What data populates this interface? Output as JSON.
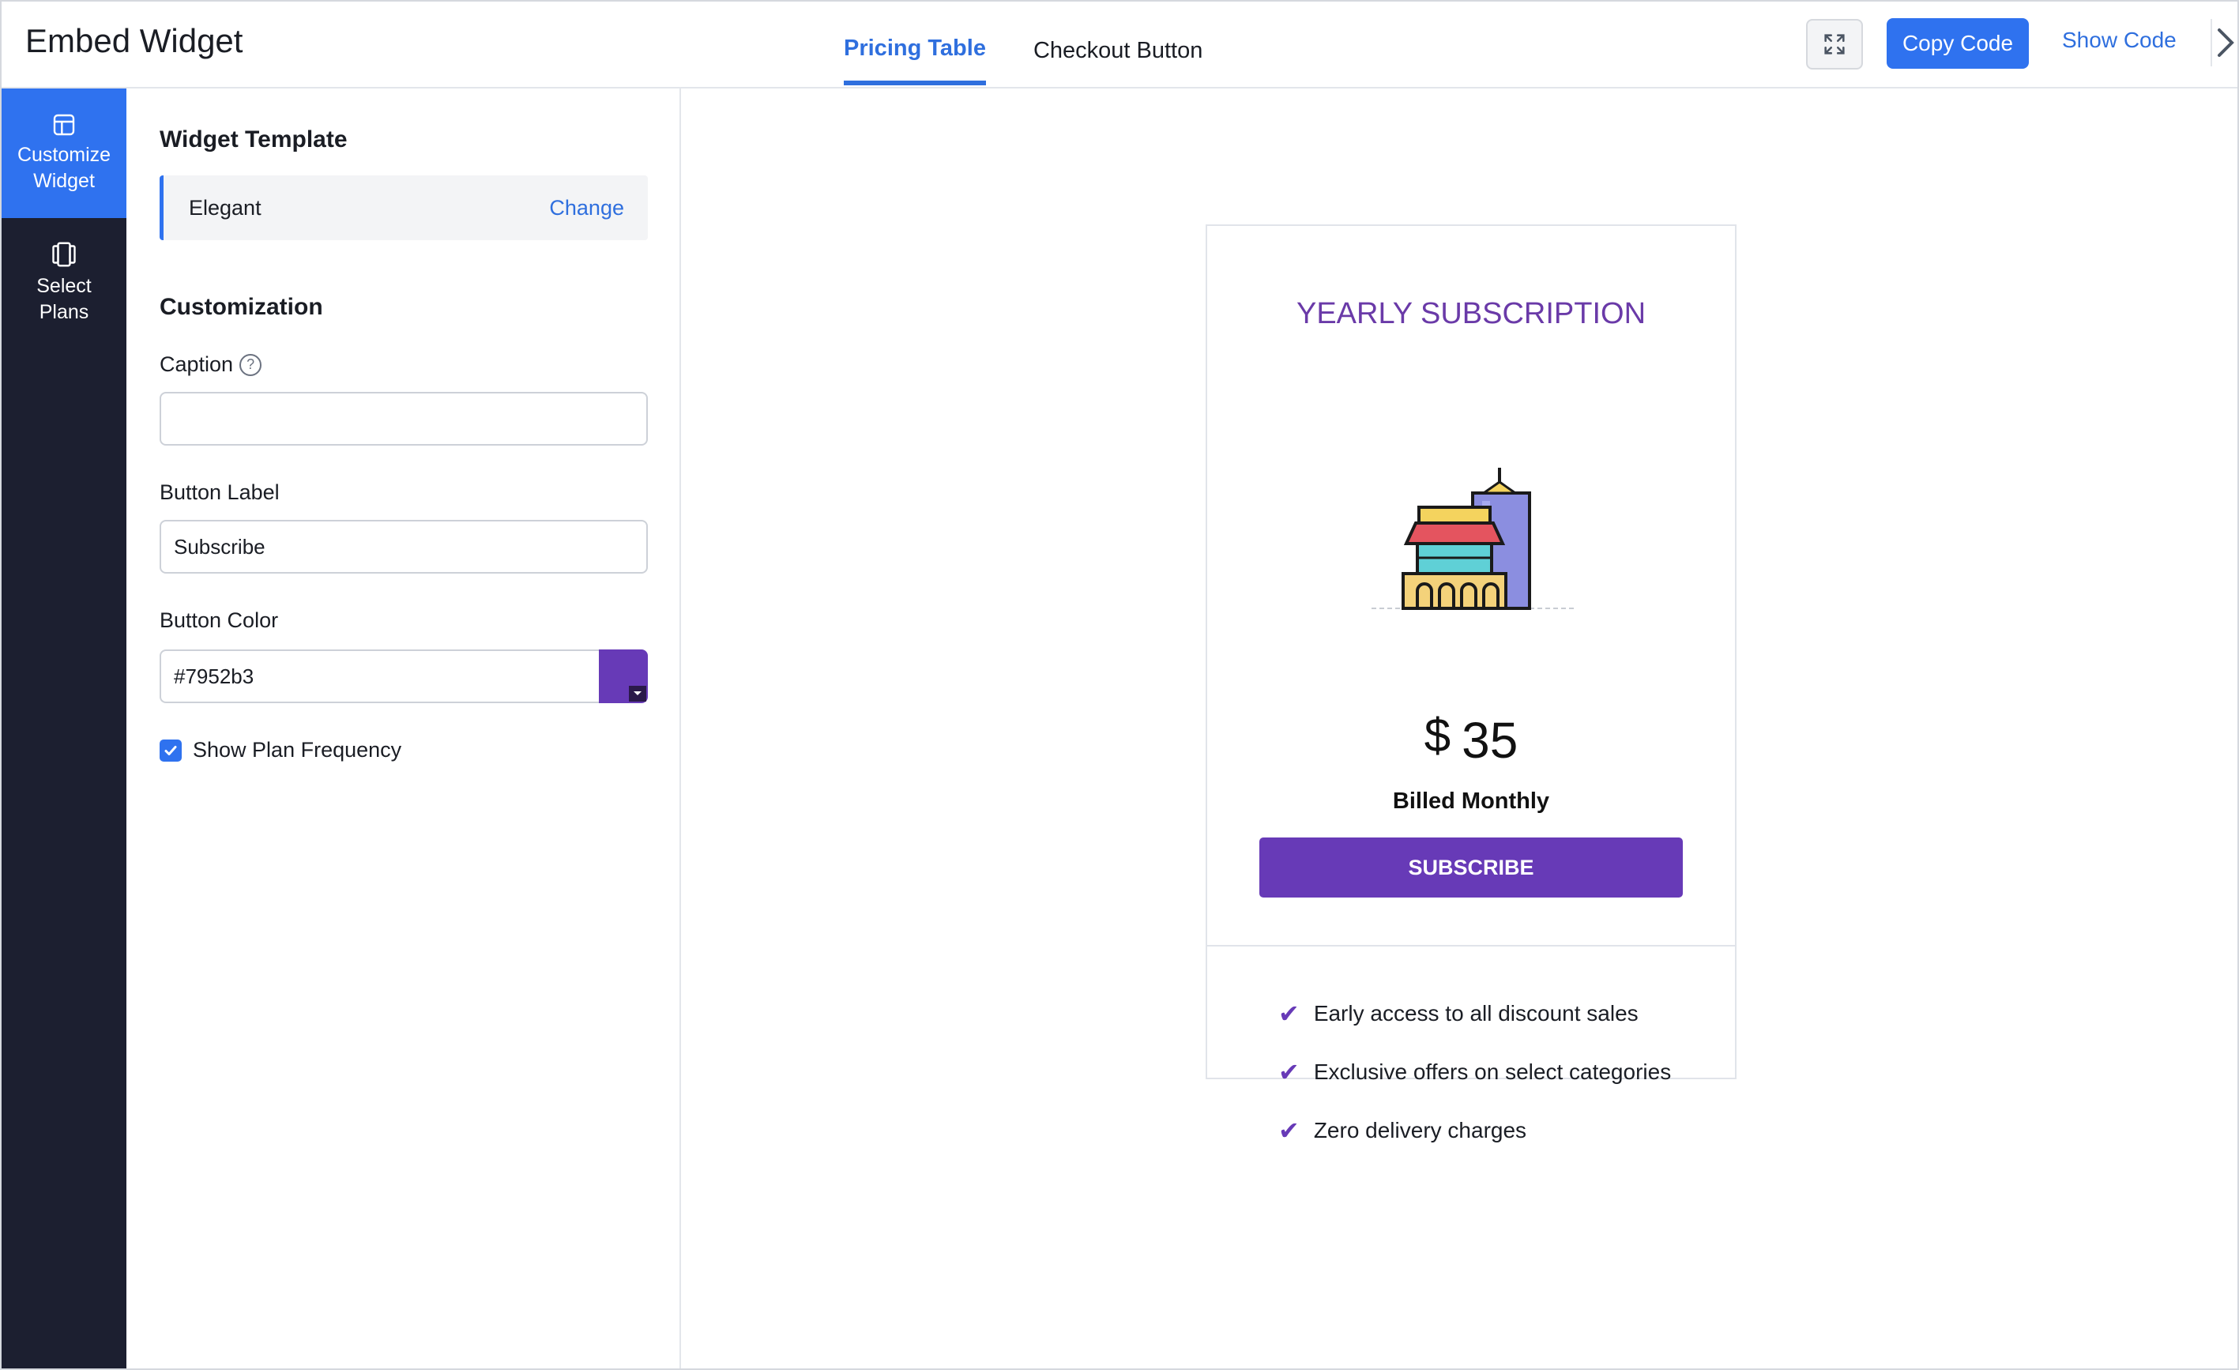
{
  "header": {
    "title": "Embed Widget",
    "tabs": [
      {
        "label": "Pricing Table",
        "active": true
      },
      {
        "label": "Checkout Button",
        "active": false
      }
    ],
    "copy_code": "Copy Code",
    "show_code": "Show Code"
  },
  "nav": {
    "items": [
      {
        "line1": "Customize",
        "line2": "Widget",
        "active": true,
        "icon": "layout-icon"
      },
      {
        "line1": "Select",
        "line2": "Plans",
        "active": false,
        "icon": "plans-icon"
      }
    ]
  },
  "panel": {
    "template_section": "Widget Template",
    "template_name": "Elegant",
    "template_change": "Change",
    "customization_section": "Customization",
    "caption_label": "Caption",
    "caption_value": "",
    "button_label_label": "Button Label",
    "button_label_value": "Subscribe",
    "button_color_label": "Button Color",
    "button_color_value": "#7952b3",
    "show_frequency_label": "Show Plan Frequency",
    "show_frequency_checked": true
  },
  "card": {
    "plan_name": "YEARLY SUBSCRIPTION",
    "currency": "$",
    "amount": "35",
    "billing": "Billed Monthly",
    "button": "SUBSCRIBE",
    "features": [
      "Early access to all discount sales",
      "Exclusive offers on select categories",
      "Zero delivery charges"
    ]
  },
  "colors": {
    "accent": "#2f72ef",
    "purple": "#673ab7",
    "plan_title": "#6a3aa8",
    "nav_bg": "#1c1f30"
  }
}
